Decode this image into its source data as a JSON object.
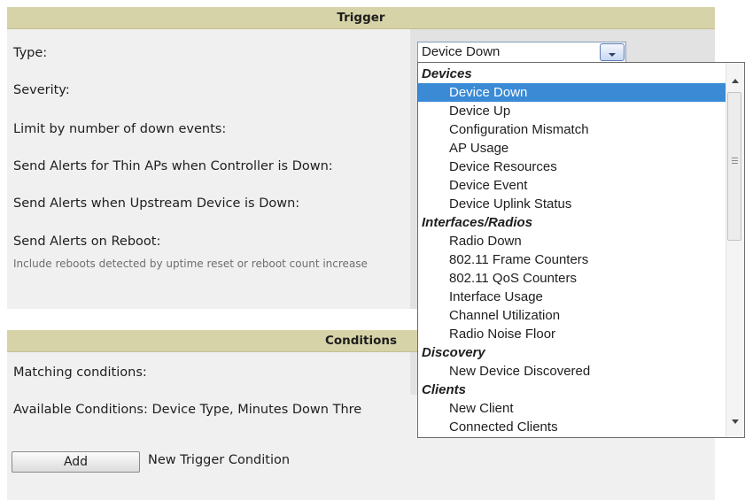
{
  "trigger": {
    "header": "Trigger",
    "labels": {
      "type": "Type:",
      "severity": "Severity:",
      "limit_down_events": "Limit by number of down events:",
      "thin_aps": "Send Alerts for Thin APs when Controller is Down:",
      "upstream_device": "Send Alerts when Upstream Device is Down:",
      "reboot": "Send Alerts on Reboot:",
      "reboot_note": "Include reboots detected by uptime reset or reboot count increase"
    },
    "type_select": {
      "value": "Device Down",
      "button_icon": "chevron-down-icon"
    }
  },
  "dropdown": {
    "groups": [
      {
        "label": "Devices",
        "items": [
          "Device Down",
          "Device Up",
          "Configuration Mismatch",
          "AP Usage",
          "Device Resources",
          "Device Event",
          "Device Uplink Status"
        ]
      },
      {
        "label": "Interfaces/Radios",
        "items": [
          "Radio Down",
          "802.11 Frame Counters",
          "802.11 QoS Counters",
          "Interface Usage",
          "Channel Utilization",
          "Radio Noise Floor"
        ]
      },
      {
        "label": "Discovery",
        "items": [
          "New Device Discovered"
        ]
      },
      {
        "label": "Clients",
        "items": [
          "New Client",
          "Connected Clients"
        ]
      }
    ],
    "selected": "Device Down",
    "colors": {
      "selected_bg": "#3a8ad6",
      "selected_text": "#ffffff"
    }
  },
  "conditions": {
    "header": "Conditions",
    "matching_label": "Matching conditions:",
    "available_label": "Available Conditions: Device Type, Minutes Down Thre",
    "add_button": "Add",
    "add_label": "New Trigger Condition"
  },
  "colors": {
    "header_bg": "#d7d3a8",
    "panel_bg": "#f0f0f0",
    "value_bg": "#e2e2e2"
  }
}
